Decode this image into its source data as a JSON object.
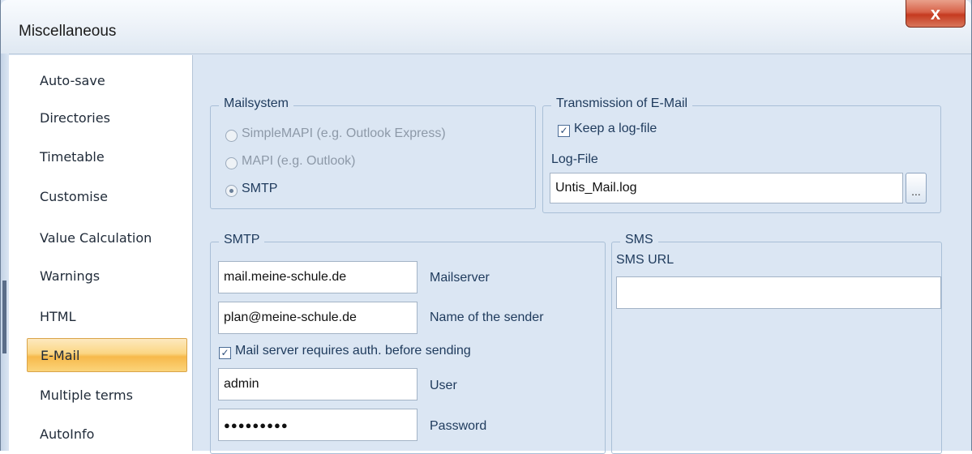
{
  "window": {
    "title": "Miscellaneous",
    "close_glyph": "x"
  },
  "sidebar": {
    "items": [
      {
        "label": "Auto-save"
      },
      {
        "label": "Directories"
      },
      {
        "label": "Timetable"
      },
      {
        "label": "Customise"
      },
      {
        "label": "Value Calculation"
      },
      {
        "label": "Warnings"
      },
      {
        "label": "HTML"
      },
      {
        "label": "E-Mail",
        "selected": true
      },
      {
        "label": "Multiple terms"
      },
      {
        "label": "AutoInfo"
      }
    ]
  },
  "mailsystem": {
    "title": "Mailsystem",
    "options": [
      {
        "label": "SimpleMAPI (e.g. Outlook Express)",
        "checked": false,
        "enabled": false
      },
      {
        "label": "MAPI (e.g. Outlook)",
        "checked": false,
        "enabled": false
      },
      {
        "label": "SMTP",
        "checked": true,
        "enabled": true
      }
    ]
  },
  "transmission": {
    "title": "Transmission of E-Mail",
    "keep_log_label": "Keep a log-file",
    "keep_log_checked": true,
    "log_file_label": "Log-File",
    "log_file_value": "Untis_Mail.log",
    "browse_label": "..."
  },
  "smtp": {
    "title": "SMTP",
    "mailserver_value": "mail.meine-schule.de",
    "mailserver_label": "Mailserver",
    "sender_value": "plan@meine-schule.de",
    "sender_label": "Name of the sender",
    "auth_label": "Mail server requires auth. before sending",
    "auth_checked": true,
    "user_value": "admin",
    "user_label": "User",
    "password_value": "●●●●●●●●●",
    "password_label": "Password"
  },
  "sms": {
    "title": "SMS",
    "url_label": "SMS URL",
    "url_value": ""
  },
  "colors": {
    "panel_bg": "#dbe6f3",
    "selected_item": "#fbd683",
    "label_text": "#1e3a5c",
    "close_button": "#c53a20"
  }
}
